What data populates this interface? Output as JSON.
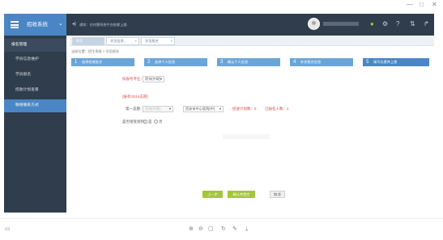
{
  "window": {
    "minimize": "—",
    "restore": "□",
    "close": "✕"
  },
  "topbar": {
    "system_title": "招收系统",
    "notice": "通知：任何慧系统平台依都上路",
    "icons": [
      "wechat-icon",
      "gear-icon",
      "help-icon",
      "sort-icon",
      "share-icon"
    ]
  },
  "sidebar": {
    "header": "报名管理",
    "items": [
      "学员信息维护",
      "学员报名",
      "招收计划查看",
      "联络联系方式"
    ],
    "active_index": 3
  },
  "tabs": [
    {
      "label": "首页"
    },
    {
      "label": "学员信息..."
    },
    {
      "label": "学员报名"
    }
  ],
  "breadcrumb": "当前位置：招生系统 > 学员报名",
  "steps": [
    {
      "num": "1",
      "label": "选择招收批次"
    },
    {
      "num": "2",
      "label": "选择个人信息"
    },
    {
      "num": "3",
      "label": "确认个人信息"
    },
    {
      "num": "4",
      "label": "补充报名信息"
    },
    {
      "num": "5",
      "label": "填写志愿并上报"
    }
  ],
  "form": {
    "major_label": "拟报考专业：",
    "major_value": "药剂(中职)",
    "volunteer_section": "[报考/2018志愿]",
    "first_choice_label": "第一志愿：",
    "first_choice_value": "药剂(中职)",
    "school_value": "西安市中心医院(中)",
    "plan_text": "招收计划数：8",
    "applied_text": "已报名人数：2",
    "adjust_label": "是否接受调剂：",
    "opt_yes": "是",
    "opt_no": "否"
  },
  "buttons": {
    "prev": "上一步",
    "confirm": "确认并提交",
    "cancel": "取消"
  },
  "bottom_icons": [
    "monitor-icon",
    "zoom-in-icon",
    "zoom-out-icon",
    "fit-icon",
    "rotate-icon",
    "edit-icon",
    "download-icon"
  ],
  "colors": {
    "dark": "#2f3d4c",
    "accent": "#4a86c5",
    "step": "#6aa5d8",
    "green": "#a4c639",
    "red": "#d9534f"
  }
}
